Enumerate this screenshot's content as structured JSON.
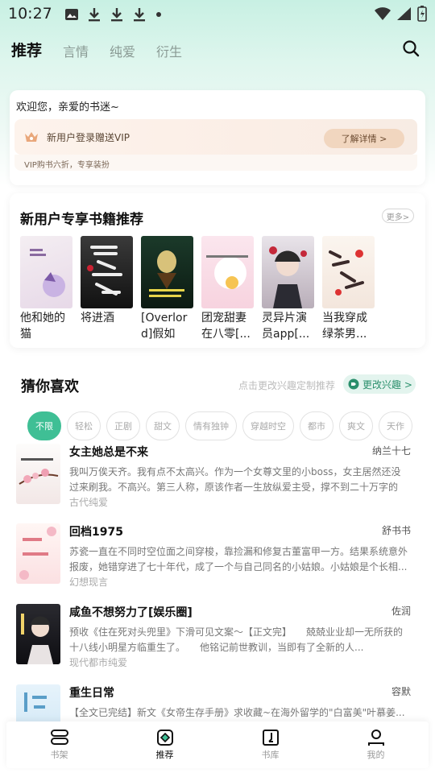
{
  "status_bar": {
    "time": "10:27",
    "icons": [
      "image-icon",
      "download-icon",
      "download-icon",
      "download-icon",
      "dot-icon"
    ],
    "right_icons": [
      "wifi-icon",
      "signal-icon",
      "battery-icon"
    ]
  },
  "top_tabs": [
    {
      "label": "推荐",
      "active": true
    },
    {
      "label": "言情",
      "active": false
    },
    {
      "label": "纯爱",
      "active": false
    },
    {
      "label": "衍生",
      "active": false
    }
  ],
  "welcome": {
    "greeting": "欢迎您，亲爱的书迷~",
    "vip_text": "新用户登录赠送VIP",
    "vip_button": "了解详情 >",
    "vip_sub": "VIP购书六折，专享装扮"
  },
  "new_user_section": {
    "title": "新用户专享书籍推荐",
    "more_label": "更多>",
    "books": [
      {
        "title": "他和她的猫"
      },
      {
        "title": "将进酒"
      },
      {
        "title": "[Overlord]假如莫..."
      },
      {
        "title": "团宠甜妻在八零[..."
      },
      {
        "title": "灵异片演员app[..."
      },
      {
        "title": "当我穿成绿茶男..."
      }
    ]
  },
  "guess": {
    "title": "猜你喜欢",
    "hint": "点击更改兴趣定制推荐",
    "change_button": "更改兴趣 >",
    "tags": [
      "不限",
      "轻松",
      "正剧",
      "甜文",
      "情有独钟",
      "穿越时空",
      "都市",
      "爽文",
      "天作"
    ],
    "items": [
      {
        "title": "女主她总是不来",
        "author": "纳兰十七",
        "desc": "我叫万俟天齐。我有点不太高兴。作为一个女尊文里的小boss，女主居然还没过来刷我。不高兴。第三人称，原该作者一生放纵爱主受，撑不到二十万字的小...",
        "tags": "古代纯爱"
      },
      {
        "title": "回档1975",
        "author": "舒书书",
        "desc": "苏瓷一直在不同时空位面之间穿梭，靠捡漏和修复古董富甲一方。结果系统意外报废，她错穿进了七十年代，成了一个与自己同名的小姑娘。小姑娘是个长相...",
        "tags": "幻想现言"
      },
      {
        "title": "咸鱼不想努力了[娱乐圈]",
        "author": "佐润",
        "desc": "预收《住在死对头兜里》下滑可见文案～【正文完】　　兢兢业业却一无所获的十八线小明星方临重生了。　　他铭记前世教训，当即有了全新的人...",
        "tags": "现代都市纯爱"
      },
      {
        "title": "重生日常",
        "author": "容默",
        "desc": "【全文已完结】新文《女帝生存手册》求收藏~在海外留学的\"白富美\"叶慕姜...",
        "tags": ""
      }
    ]
  },
  "bottom_nav": [
    {
      "label": "书架",
      "icon": "bookshelf-icon",
      "active": false
    },
    {
      "label": "推荐",
      "icon": "recommend-icon",
      "active": true
    },
    {
      "label": "书库",
      "icon": "library-icon",
      "active": false
    },
    {
      "label": "我的",
      "icon": "profile-icon",
      "active": false
    }
  ],
  "colors": {
    "accent": "#3fbf95",
    "vip_button": "#f1d6bf",
    "header_gradient": "#c8f0e3"
  }
}
